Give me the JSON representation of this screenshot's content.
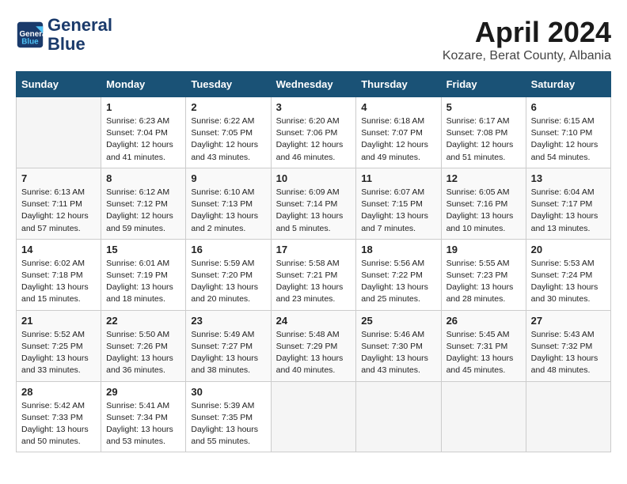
{
  "header": {
    "logo_line1": "General",
    "logo_line2": "Blue",
    "month_title": "April 2024",
    "location": "Kozare, Berat County, Albania"
  },
  "weekdays": [
    "Sunday",
    "Monday",
    "Tuesday",
    "Wednesday",
    "Thursday",
    "Friday",
    "Saturday"
  ],
  "weeks": [
    [
      {
        "day": "",
        "info": ""
      },
      {
        "day": "1",
        "info": "Sunrise: 6:23 AM\nSunset: 7:04 PM\nDaylight: 12 hours\nand 41 minutes."
      },
      {
        "day": "2",
        "info": "Sunrise: 6:22 AM\nSunset: 7:05 PM\nDaylight: 12 hours\nand 43 minutes."
      },
      {
        "day": "3",
        "info": "Sunrise: 6:20 AM\nSunset: 7:06 PM\nDaylight: 12 hours\nand 46 minutes."
      },
      {
        "day": "4",
        "info": "Sunrise: 6:18 AM\nSunset: 7:07 PM\nDaylight: 12 hours\nand 49 minutes."
      },
      {
        "day": "5",
        "info": "Sunrise: 6:17 AM\nSunset: 7:08 PM\nDaylight: 12 hours\nand 51 minutes."
      },
      {
        "day": "6",
        "info": "Sunrise: 6:15 AM\nSunset: 7:10 PM\nDaylight: 12 hours\nand 54 minutes."
      }
    ],
    [
      {
        "day": "7",
        "info": "Sunrise: 6:13 AM\nSunset: 7:11 PM\nDaylight: 12 hours\nand 57 minutes."
      },
      {
        "day": "8",
        "info": "Sunrise: 6:12 AM\nSunset: 7:12 PM\nDaylight: 12 hours\nand 59 minutes."
      },
      {
        "day": "9",
        "info": "Sunrise: 6:10 AM\nSunset: 7:13 PM\nDaylight: 13 hours\nand 2 minutes."
      },
      {
        "day": "10",
        "info": "Sunrise: 6:09 AM\nSunset: 7:14 PM\nDaylight: 13 hours\nand 5 minutes."
      },
      {
        "day": "11",
        "info": "Sunrise: 6:07 AM\nSunset: 7:15 PM\nDaylight: 13 hours\nand 7 minutes."
      },
      {
        "day": "12",
        "info": "Sunrise: 6:05 AM\nSunset: 7:16 PM\nDaylight: 13 hours\nand 10 minutes."
      },
      {
        "day": "13",
        "info": "Sunrise: 6:04 AM\nSunset: 7:17 PM\nDaylight: 13 hours\nand 13 minutes."
      }
    ],
    [
      {
        "day": "14",
        "info": "Sunrise: 6:02 AM\nSunset: 7:18 PM\nDaylight: 13 hours\nand 15 minutes."
      },
      {
        "day": "15",
        "info": "Sunrise: 6:01 AM\nSunset: 7:19 PM\nDaylight: 13 hours\nand 18 minutes."
      },
      {
        "day": "16",
        "info": "Sunrise: 5:59 AM\nSunset: 7:20 PM\nDaylight: 13 hours\nand 20 minutes."
      },
      {
        "day": "17",
        "info": "Sunrise: 5:58 AM\nSunset: 7:21 PM\nDaylight: 13 hours\nand 23 minutes."
      },
      {
        "day": "18",
        "info": "Sunrise: 5:56 AM\nSunset: 7:22 PM\nDaylight: 13 hours\nand 25 minutes."
      },
      {
        "day": "19",
        "info": "Sunrise: 5:55 AM\nSunset: 7:23 PM\nDaylight: 13 hours\nand 28 minutes."
      },
      {
        "day": "20",
        "info": "Sunrise: 5:53 AM\nSunset: 7:24 PM\nDaylight: 13 hours\nand 30 minutes."
      }
    ],
    [
      {
        "day": "21",
        "info": "Sunrise: 5:52 AM\nSunset: 7:25 PM\nDaylight: 13 hours\nand 33 minutes."
      },
      {
        "day": "22",
        "info": "Sunrise: 5:50 AM\nSunset: 7:26 PM\nDaylight: 13 hours\nand 36 minutes."
      },
      {
        "day": "23",
        "info": "Sunrise: 5:49 AM\nSunset: 7:27 PM\nDaylight: 13 hours\nand 38 minutes."
      },
      {
        "day": "24",
        "info": "Sunrise: 5:48 AM\nSunset: 7:29 PM\nDaylight: 13 hours\nand 40 minutes."
      },
      {
        "day": "25",
        "info": "Sunrise: 5:46 AM\nSunset: 7:30 PM\nDaylight: 13 hours\nand 43 minutes."
      },
      {
        "day": "26",
        "info": "Sunrise: 5:45 AM\nSunset: 7:31 PM\nDaylight: 13 hours\nand 45 minutes."
      },
      {
        "day": "27",
        "info": "Sunrise: 5:43 AM\nSunset: 7:32 PM\nDaylight: 13 hours\nand 48 minutes."
      }
    ],
    [
      {
        "day": "28",
        "info": "Sunrise: 5:42 AM\nSunset: 7:33 PM\nDaylight: 13 hours\nand 50 minutes."
      },
      {
        "day": "29",
        "info": "Sunrise: 5:41 AM\nSunset: 7:34 PM\nDaylight: 13 hours\nand 53 minutes."
      },
      {
        "day": "30",
        "info": "Sunrise: 5:39 AM\nSunset: 7:35 PM\nDaylight: 13 hours\nand 55 minutes."
      },
      {
        "day": "",
        "info": ""
      },
      {
        "day": "",
        "info": ""
      },
      {
        "day": "",
        "info": ""
      },
      {
        "day": "",
        "info": ""
      }
    ]
  ]
}
